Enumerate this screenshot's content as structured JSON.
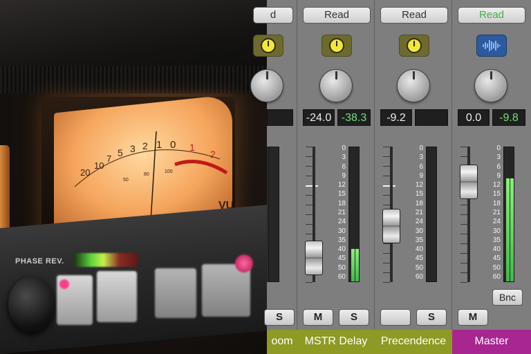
{
  "photo": {
    "panel_label": "PHASE REV.",
    "meter_scale": [
      "20",
      "10",
      "7",
      "5",
      "3",
      "2",
      "1",
      "0",
      "1",
      "2"
    ],
    "meter_unit": "VU",
    "meter_sub_labels": [
      "50",
      "80",
      "100"
    ]
  },
  "strips": [
    {
      "id": "room",
      "read_label": "d",
      "ms": [
        "S"
      ],
      "name": "oom",
      "name_color": "#8e9a23"
    },
    {
      "id": "mstr-delay",
      "read_label": "Read",
      "pan_value": "-24.0",
      "peak_value": "-38.3",
      "fader_level_db": "-40",
      "meter_level_fraction": 0.24,
      "ms": [
        "M",
        "S"
      ],
      "name": "MSTR Delay",
      "name_color": "#8e9a23"
    },
    {
      "id": "precedence",
      "read_label": "Read",
      "pan_value": "-9.2",
      "peak_value": "",
      "fader_level_db": "-27",
      "meter_level_fraction": 0,
      "ms": [
        "",
        "S"
      ],
      "name": "Precendence",
      "name_color": "#8e9a23"
    },
    {
      "id": "master",
      "read_label": "Read",
      "read_color": "#3fae4a",
      "pan_value": "0.0",
      "peak_value": "-9.8",
      "fader_level_db": "-10",
      "meter_level_fraction": 0.77,
      "bnc_label": "Bnc",
      "ms": [
        "M"
      ],
      "name": "Master",
      "name_color": "#a8268f"
    }
  ],
  "fader_scale": [
    "0",
    "3",
    "6",
    "9",
    "12",
    "15",
    "18",
    "21",
    "24",
    "30",
    "35",
    "40",
    "45",
    "50",
    "60"
  ],
  "icons": {
    "plugin": "yellow-dial-icon",
    "master_plugin": "waveform-icon"
  }
}
